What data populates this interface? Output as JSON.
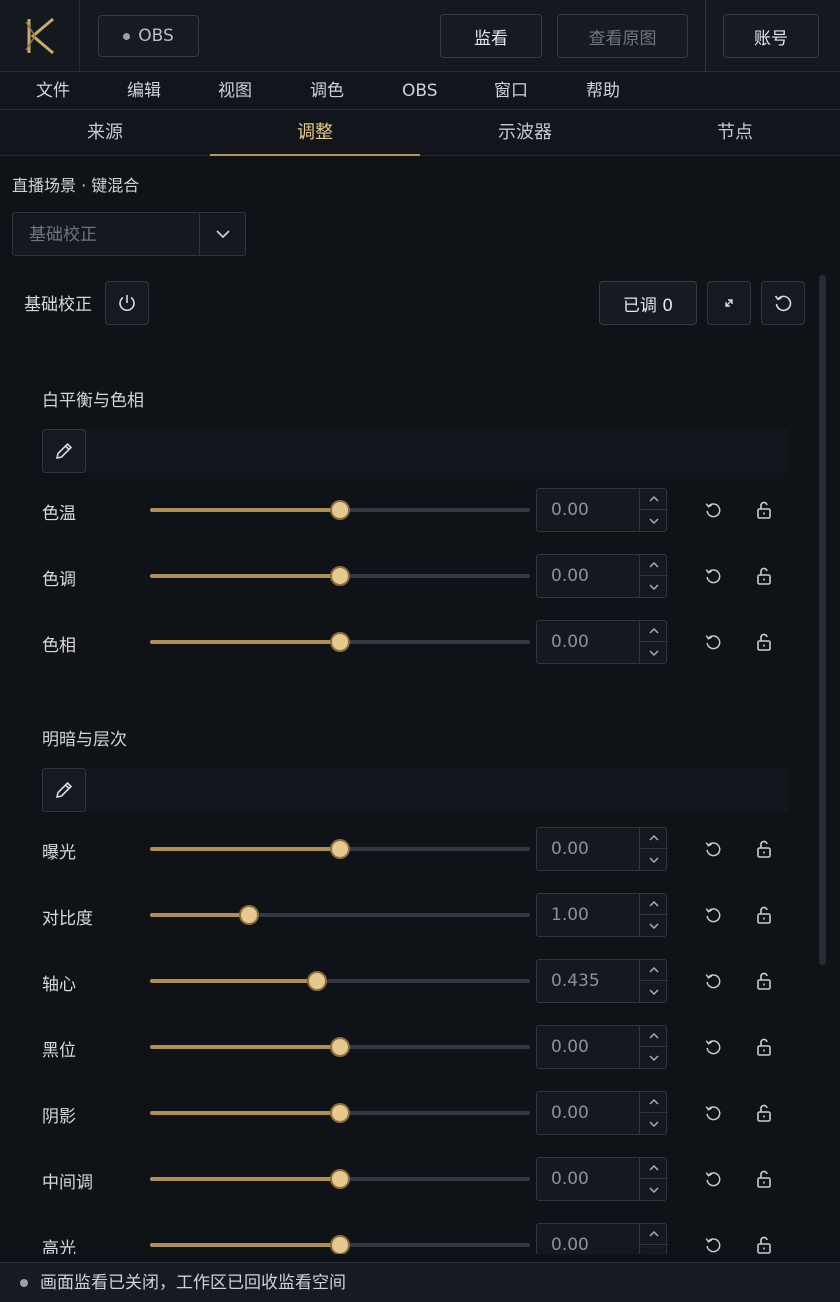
{
  "header": {
    "obs_label": "OBS",
    "monitor_label": "监看",
    "view_original_label": "查看原图",
    "account_label": "账号"
  },
  "menu": [
    "文件",
    "编辑",
    "视图",
    "调色",
    "OBS",
    "窗口",
    "帮助"
  ],
  "tabs": [
    {
      "label": "来源",
      "active": false
    },
    {
      "label": "调整",
      "active": true
    },
    {
      "label": "示波器",
      "active": false
    },
    {
      "label": "节点",
      "active": false
    }
  ],
  "panel": {
    "scene_title": "直播场景 · 键混合",
    "preset_value": "基础校正",
    "section_label": "基础校正",
    "adjusted_label": "已调 0"
  },
  "groups": [
    {
      "title": "白平衡与色相",
      "rows": [
        {
          "label": "色温",
          "value": "0.00",
          "fraction": 0.5
        },
        {
          "label": "色调",
          "value": "0.00",
          "fraction": 0.5
        },
        {
          "label": "色相",
          "value": "0.00",
          "fraction": 0.5
        }
      ]
    },
    {
      "title": "明暗与层次",
      "rows": [
        {
          "label": "曝光",
          "value": "0.00",
          "fraction": 0.5
        },
        {
          "label": "对比度",
          "value": "1.00",
          "fraction": 0.26
        },
        {
          "label": "轴心",
          "value": "0.435",
          "fraction": 0.44
        },
        {
          "label": "黑位",
          "value": "0.00",
          "fraction": 0.5
        },
        {
          "label": "阴影",
          "value": "0.00",
          "fraction": 0.5
        },
        {
          "label": "中间调",
          "value": "0.00",
          "fraction": 0.5
        },
        {
          "label": "高光",
          "value": "0.00",
          "fraction": 0.5
        }
      ]
    }
  ],
  "status": {
    "text": "画面监看已关闭，工作区已回收监看空间"
  },
  "colors": {
    "accent": "#b08f55",
    "thumb": "#e6c98e",
    "background": "#0f1217"
  }
}
